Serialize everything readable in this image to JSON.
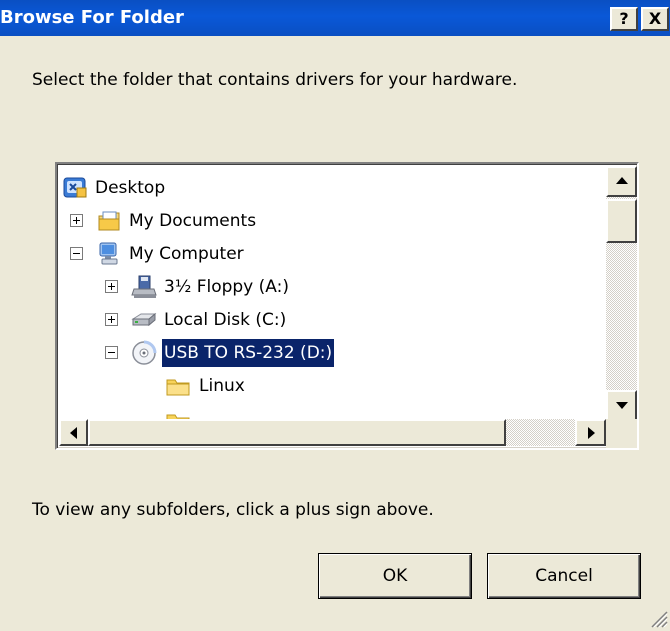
{
  "window": {
    "title": "Browse For Folder",
    "help_label": "?",
    "close_label": "X"
  },
  "instruction": "Select the folder that contains drivers for your hardware.",
  "tree": {
    "items": [
      {
        "label": "Desktop",
        "icon": "desktop-icon",
        "expander": "none",
        "selected": false
      },
      {
        "label": "My Documents",
        "icon": "my-documents-icon",
        "expander": "plus",
        "selected": false
      },
      {
        "label": "My Computer",
        "icon": "my-computer-icon",
        "expander": "minus",
        "selected": false
      },
      {
        "label": "3½ Floppy (A:)",
        "icon": "floppy-drive-icon",
        "expander": "plus",
        "selected": false
      },
      {
        "label": "Local Disk (C:)",
        "icon": "hard-disk-icon",
        "expander": "plus",
        "selected": false
      },
      {
        "label": "USB TO RS-232 (D:)",
        "icon": "cd-drive-icon",
        "expander": "minus",
        "selected": true
      },
      {
        "label": "Linux",
        "icon": "folder-icon",
        "expander": "none",
        "selected": false
      }
    ]
  },
  "hint": "To view any subfolders, click a plus sign above.",
  "buttons": {
    "ok": "OK",
    "cancel": "Cancel"
  },
  "colors": {
    "titlebar": "#0a4fc2",
    "selection": "#0a246a",
    "dialog_bg": "#ece9d8"
  }
}
